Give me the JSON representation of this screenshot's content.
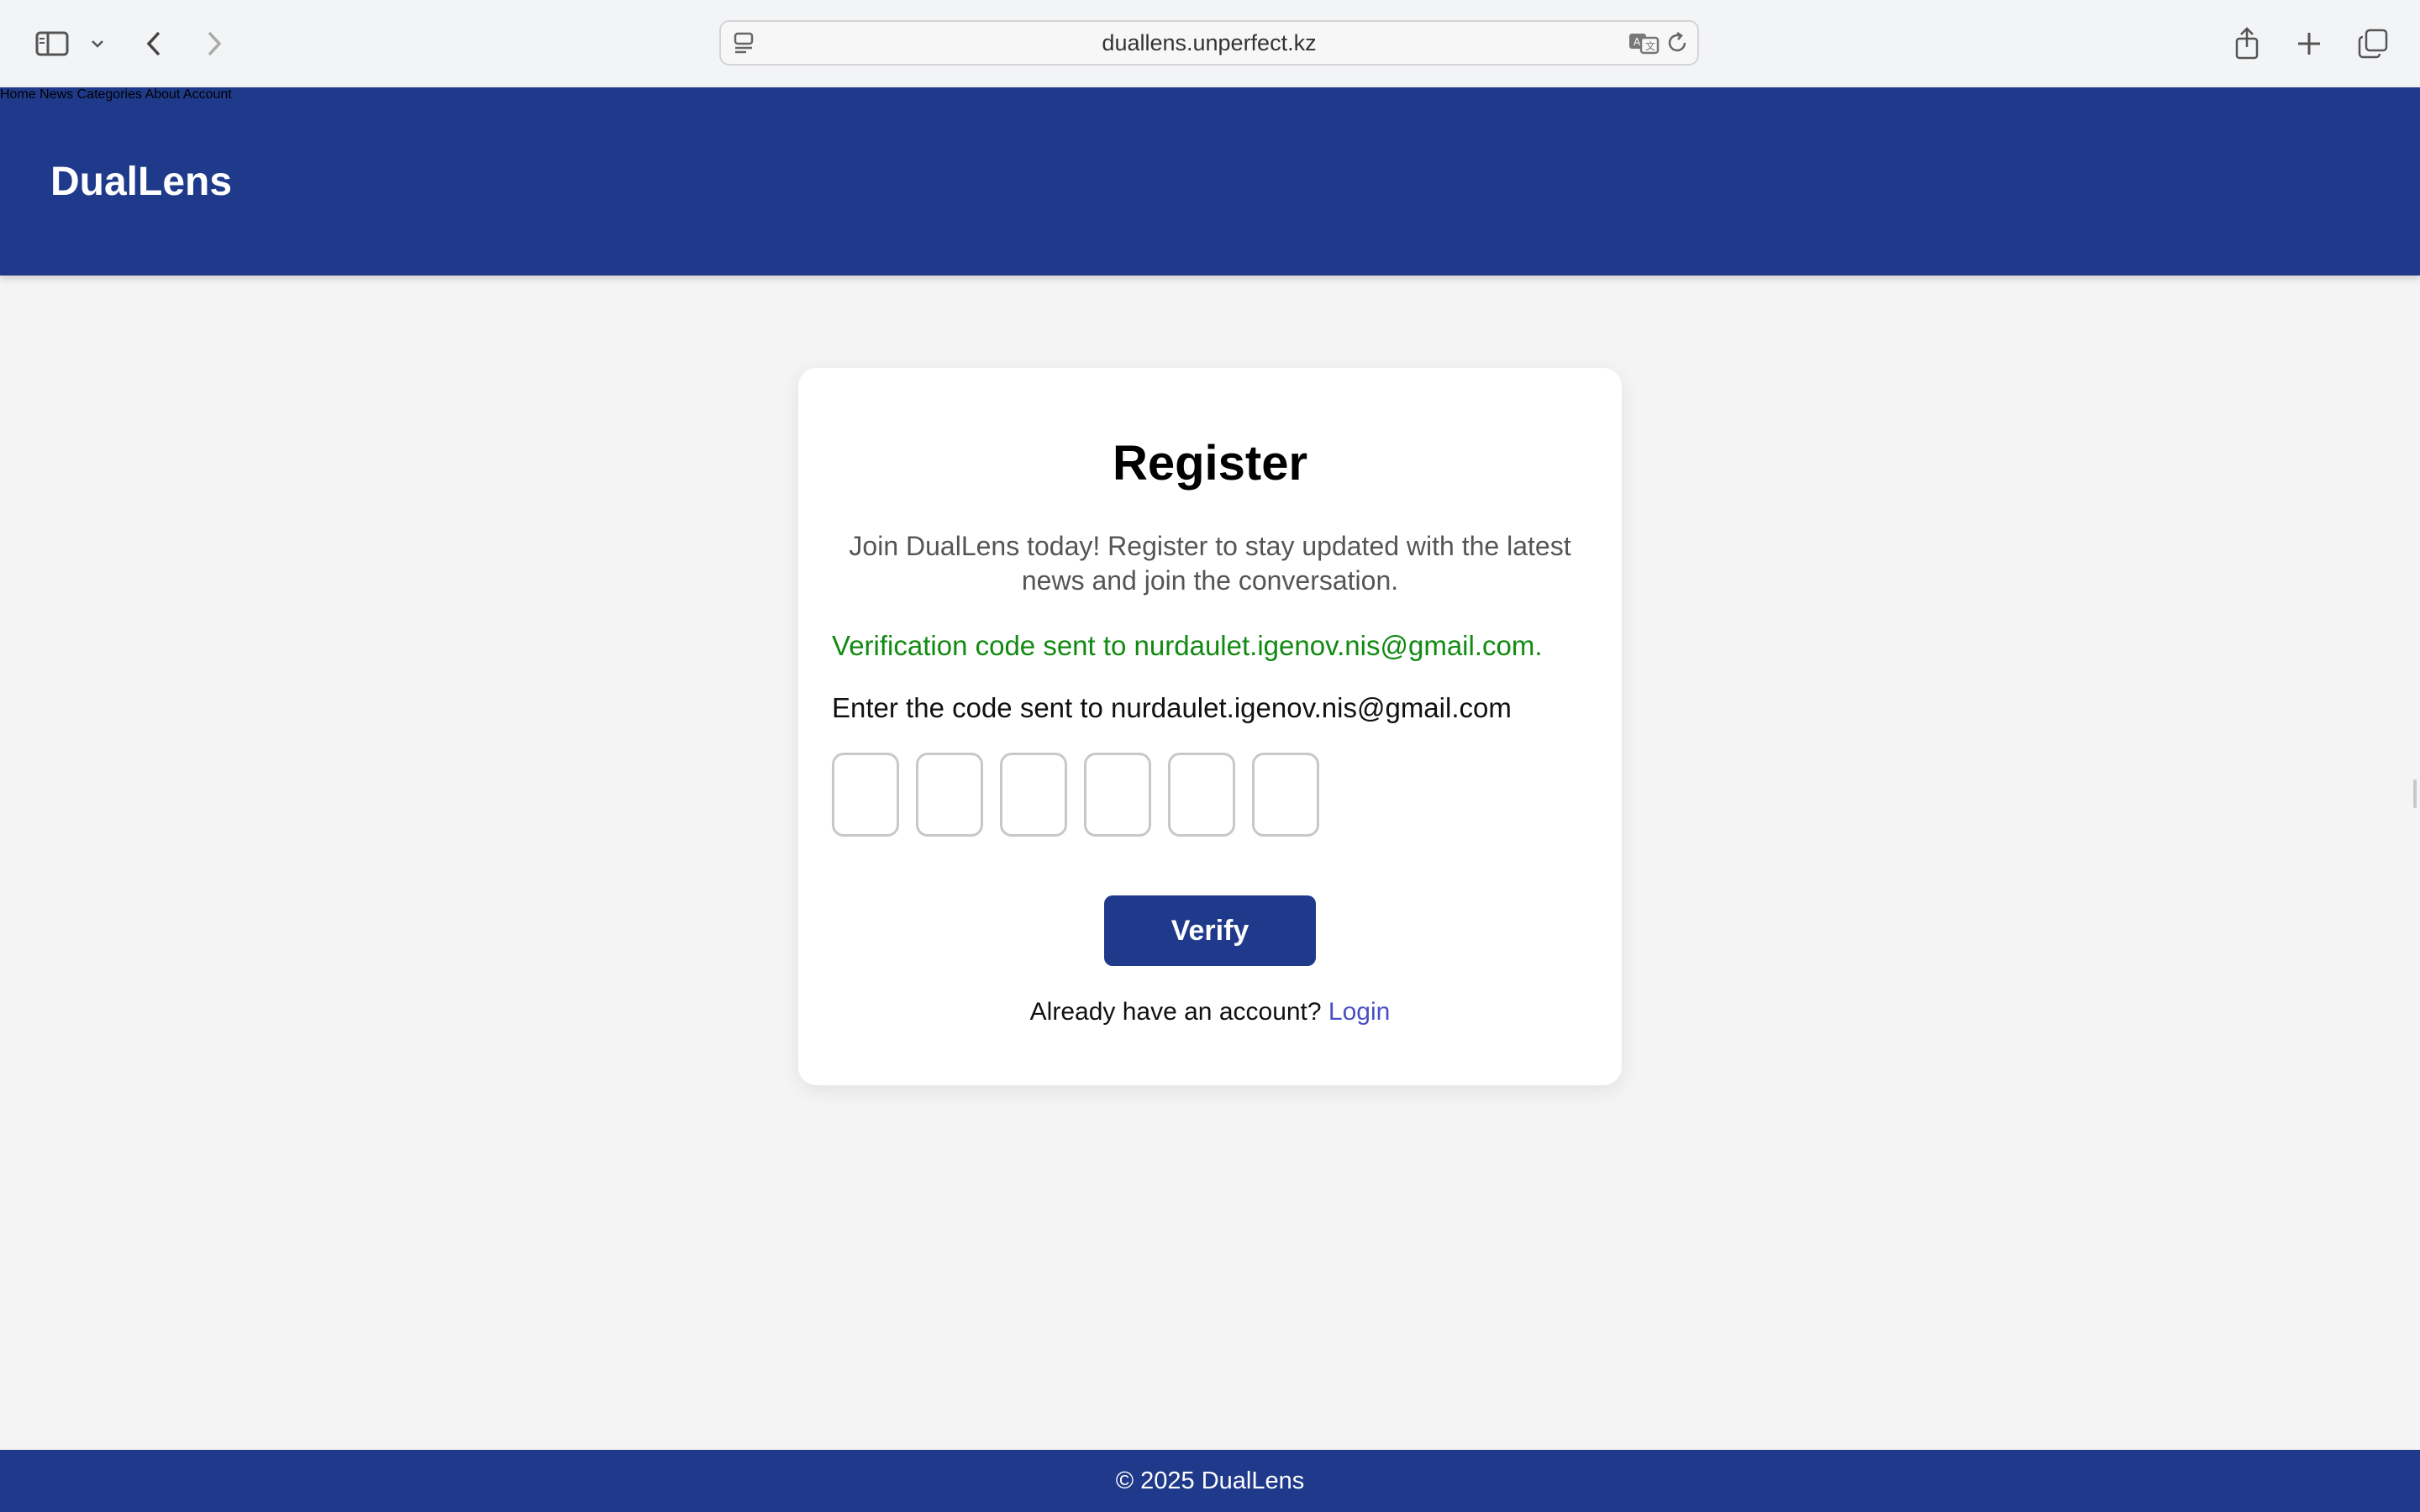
{
  "browser": {
    "url": "duallens.unperfect.kz",
    "icons": [
      "sidebar-icon",
      "chevron-down-icon",
      "back-icon",
      "forward-icon",
      "page-menu-icon",
      "translate-icon",
      "reload-icon",
      "share-icon",
      "new-tab-icon",
      "tabs-overview-icon"
    ]
  },
  "header": {
    "logo": "DualLens",
    "nav": [
      "Home",
      "News",
      "Categories",
      "About",
      "Account"
    ]
  },
  "register": {
    "title": "Register",
    "subtitle": "Join DualLens today! Register to stay updated with the latest news and join the conversation.",
    "verification_message": "Verification code sent to nurdaulet.igenov.nis@gmail.com.",
    "code_label": "Enter the code sent to nurdaulet.igenov.nis@gmail.com",
    "code_digits": [
      "",
      "",
      "",
      "",
      "",
      ""
    ],
    "verify_label": "Verify",
    "login_prompt": "Already have an account?",
    "login_link": "Login"
  },
  "footer": {
    "text": "© 2025 DualLens"
  },
  "colors": {
    "brand": "#1f3a8a",
    "success": "#118a11",
    "link": "#4a4fc4",
    "page_bg": "#f4f4f4"
  }
}
